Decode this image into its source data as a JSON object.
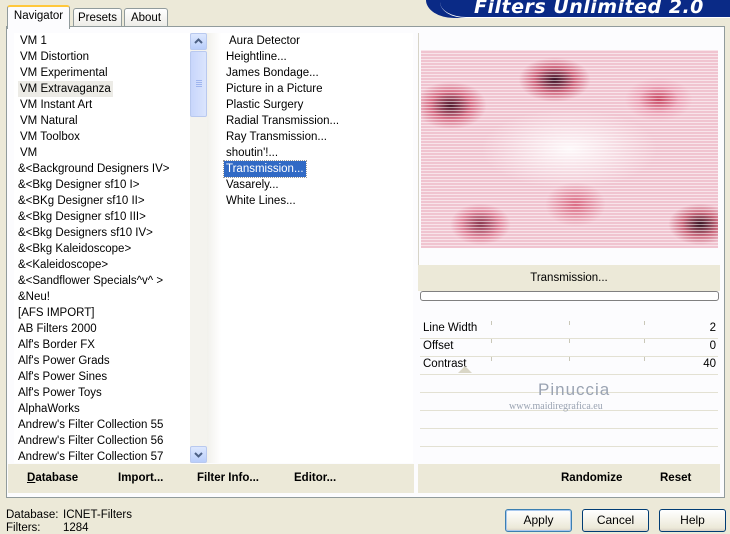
{
  "banner": {
    "title": "Filters Unlimited 2.0"
  },
  "tabs": [
    {
      "label": "Navigator"
    },
    {
      "label": "Presets"
    },
    {
      "label": "About"
    }
  ],
  "categories": [
    "VM 1",
    "VM Distortion",
    "VM Experimental",
    "VM Extravaganza",
    "VM Instant Art",
    "VM Natural",
    "VM Toolbox",
    "VM",
    "&<Background Designers IV>",
    "&<Bkg Designer sf10 I>",
    "&<BKg Designer sf10 II>",
    "&<Bkg Designer sf10 III>",
    "&<Bkg Designers sf10 IV>",
    "&<Bkg Kaleidoscope>",
    "&<Kaleidoscope>",
    "&<Sandflower Specials^v^ >",
    "&Neu!",
    "[AFS IMPORT]",
    "AB Filters 2000",
    "Alf's Border FX",
    "Alf's Power Grads",
    "Alf's Power Sines",
    "Alf's Power Toys",
    "AlphaWorks",
    "Andrew's Filter Collection 55",
    "Andrew's Filter Collection 56",
    "Andrew's Filter Collection 57"
  ],
  "selected_category": "VM Extravaganza",
  "filters": [
    "Aura Detector",
    "Heightline...",
    "James Bondage...",
    "Picture in a Picture",
    "Plastic Surgery",
    "Radial Transmission...",
    "Ray Transmission...",
    "shoutin'!...",
    "Transmission...",
    "Vasarely...",
    "White Lines..."
  ],
  "selected_filter": "Transmission...",
  "preview": {
    "filter_name": "Transmission..."
  },
  "params": [
    {
      "label": "Line Width",
      "value": "2"
    },
    {
      "label": "Offset",
      "value": "0"
    },
    {
      "label": "Contrast",
      "value": "40"
    }
  ],
  "watermark": {
    "name": "Pinuccia",
    "url": "www.maidiregrafica.eu"
  },
  "bottom_buttons": {
    "database": "Database",
    "import": "Import...",
    "filter_info": "Filter Info...",
    "editor": "Editor...",
    "randomize": "Randomize",
    "reset": "Reset"
  },
  "status": {
    "database_label": "Database:",
    "database_value": "ICNET-Filters",
    "filters_label": "Filters:",
    "filters_value": "1284"
  },
  "dialog_buttons": {
    "apply": "Apply",
    "cancel": "Cancel",
    "help": "Help"
  },
  "colors": {
    "selection": "#316ac5",
    "banner": "#0a2a86",
    "face": "#ece9d8"
  }
}
